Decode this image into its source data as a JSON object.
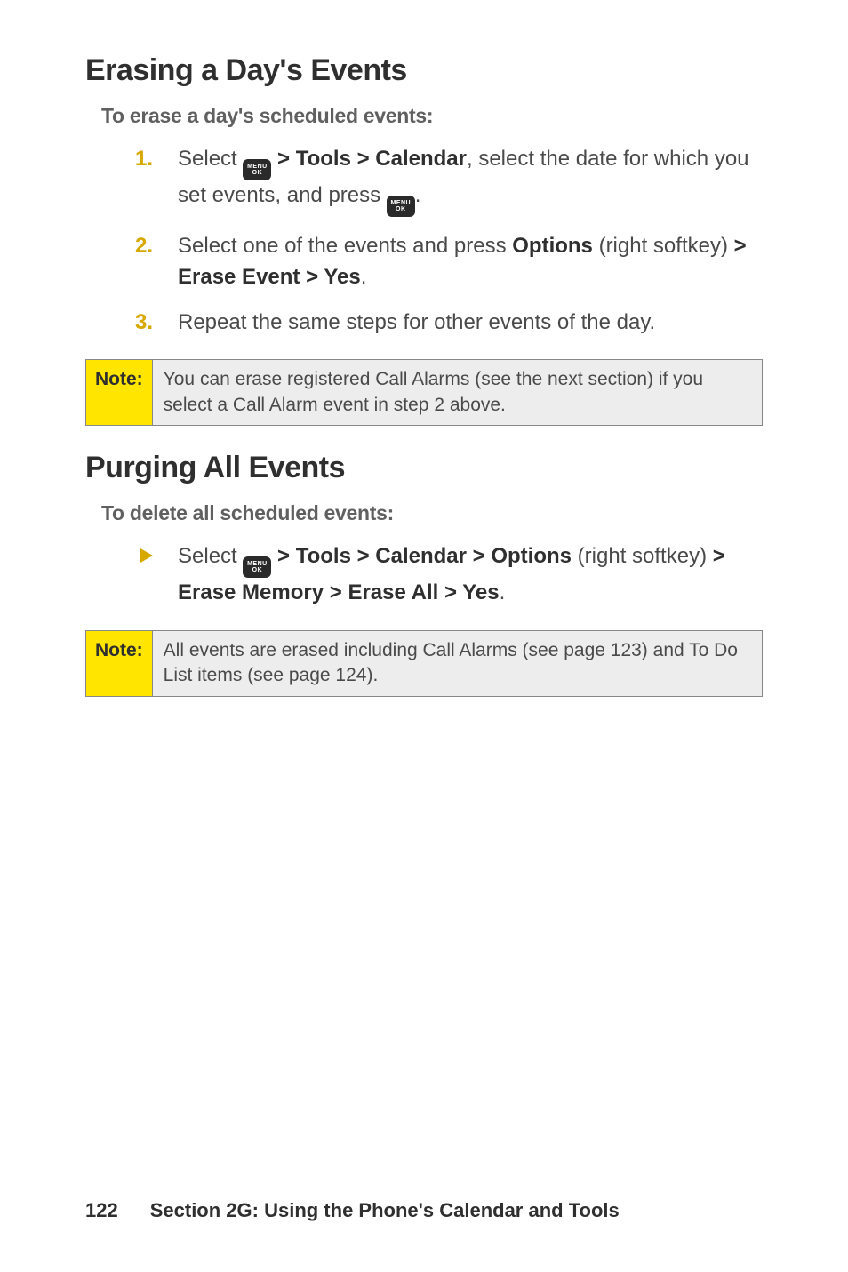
{
  "icons": {
    "menu_top": "MENU",
    "menu_bot": "OK"
  },
  "section1": {
    "heading": "Erasing a Day's Events",
    "subheading": "To erase a day's scheduled events:",
    "step1_a": "Select ",
    "step1_b": " > Tools > Calendar",
    "step1_c": ", select the date for which you set events, and press ",
    "step1_d": ".",
    "step2_a": "Select one of the events and press ",
    "step2_b": "Options",
    "step2_c": " (right softkey) ",
    "step2_d": "> Erase Event > Yes",
    "step2_e": ".",
    "step3": "Repeat the same steps for other events of the day.",
    "note_label": "Note:",
    "note_text": "You can erase registered Call Alarms (see the next section) if you select a Call Alarm event in step 2 above."
  },
  "section2": {
    "heading": "Purging All Events",
    "subheading": "To delete all scheduled events:",
    "bullet_a": "Select ",
    "bullet_b": " > Tools > Calendar > Options",
    "bullet_c": " (right softkey) ",
    "bullet_d": "> Erase Memory > Erase All > Yes",
    "bullet_e": ".",
    "note_label": "Note:",
    "note_text": "All events are erased including Call Alarms (see page 123) and To Do List items (see page 124)."
  },
  "footer": {
    "page_number": "122",
    "section_label": "Section 2G: Using the Phone's Calendar and Tools"
  }
}
